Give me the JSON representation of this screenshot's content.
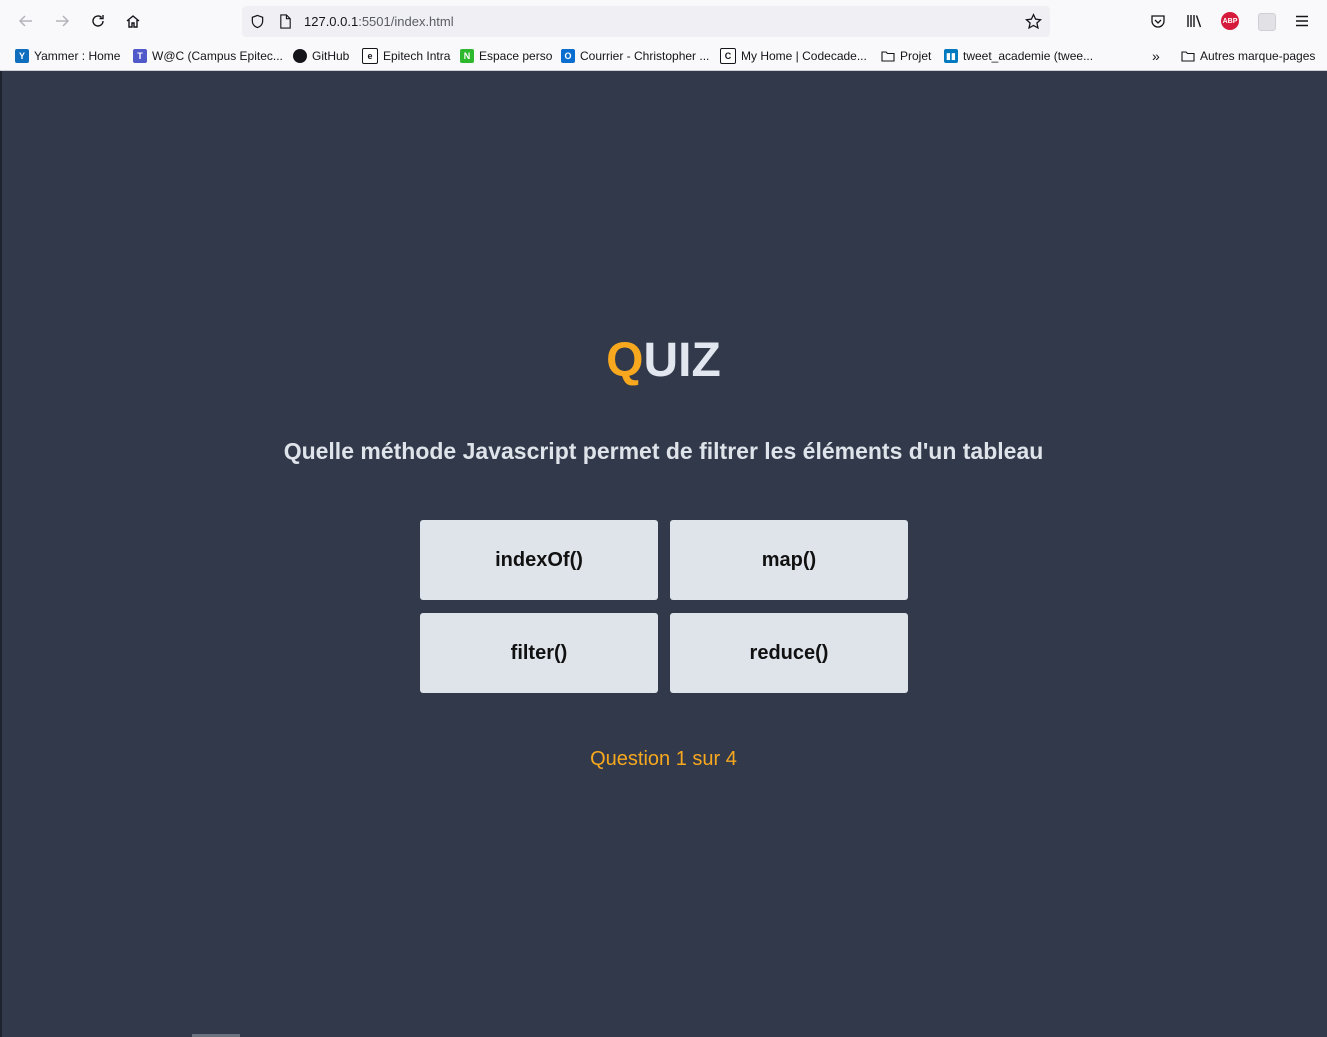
{
  "browser": {
    "url_host": "127.0.0.1",
    "url_rest": ":5501/index.html",
    "bookmarks": [
      {
        "label": "Yammer : Home",
        "icon": "yammer-icon",
        "color": "#106ebe"
      },
      {
        "label": "W@C (Campus Epitec...",
        "icon": "teams-icon",
        "color": "#5059c9"
      },
      {
        "label": "GitHub",
        "icon": "github-icon",
        "color": "#15141a"
      },
      {
        "label": "Epitech Intra",
        "icon": "epitech-icon",
        "color": "#15141a"
      },
      {
        "label": "Espace perso",
        "icon": "espace-perso-icon",
        "color": "#2eb82e"
      },
      {
        "label": "Courrier - Christopher ...",
        "icon": "outlook-icon",
        "color": "#0a6ed1"
      },
      {
        "label": "My Home | Codecade...",
        "icon": "codecademy-icon",
        "color": "#15141a"
      },
      {
        "label": "Projet",
        "icon": "folder-icon",
        "color": "#15141a"
      },
      {
        "label": "tweet_academie (twee...",
        "icon": "trello-icon",
        "color": "#0079bf"
      }
    ],
    "other_bookmarks": "Autres marque-pages"
  },
  "quiz": {
    "title_first": "Q",
    "title_rest": "UIZ",
    "question": "Quelle méthode Javascript permet de filtrer les éléments d'un tableau",
    "answers": [
      "indexOf()",
      "map()",
      "filter()",
      "reduce()"
    ],
    "counter": "Question 1 sur 4",
    "accent_color": "#f7a81e",
    "background_color": "#31394a"
  }
}
